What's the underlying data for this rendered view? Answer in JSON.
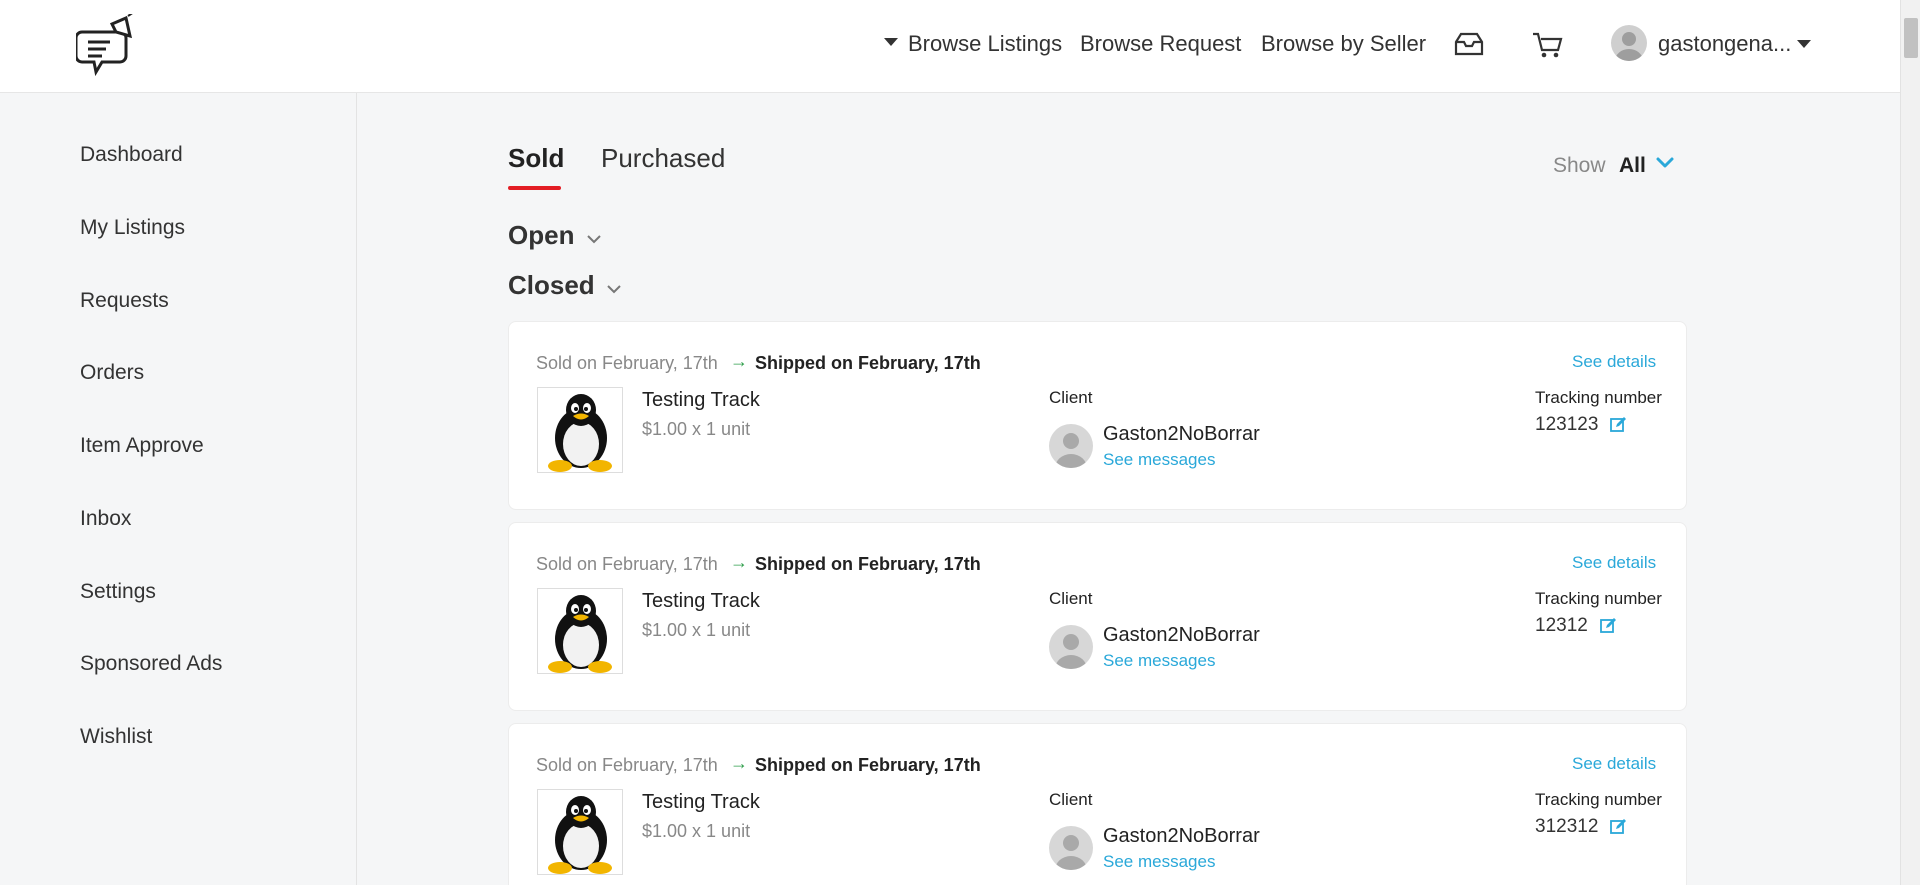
{
  "header": {
    "nav": {
      "browse_listings": "Browse Listings",
      "browse_request": "Browse Request",
      "browse_by_seller": "Browse by Seller"
    },
    "user_name": "gastongena...",
    "icons": [
      "logo-icon",
      "inbox-icon",
      "cart-icon",
      "avatar-icon",
      "chevron-down-icon"
    ]
  },
  "sidebar": {
    "items": [
      {
        "label": "Dashboard"
      },
      {
        "label": "My Listings"
      },
      {
        "label": "Requests"
      },
      {
        "label": "Orders"
      },
      {
        "label": "Item Approve"
      },
      {
        "label": "Inbox"
      },
      {
        "label": "Settings"
      },
      {
        "label": "Sponsored Ads"
      },
      {
        "label": "Wishlist"
      }
    ]
  },
  "main": {
    "tabs": [
      {
        "label": "Sold",
        "active": true
      },
      {
        "label": "Purchased",
        "active": false
      }
    ],
    "show_label": "Show",
    "show_value": "All",
    "sections": {
      "open": "Open",
      "closed": "Closed"
    },
    "orders": [
      {
        "sold_on": "Sold on February, 17th",
        "shipped": "Shipped on February, 17th",
        "see_details": "See details",
        "item_title": "Testing Track",
        "item_price": "$1.00 x 1 unit",
        "client_label": "Client",
        "client_name": "Gaston2NoBorrar",
        "see_messages": "See messages",
        "tracking_label": "Tracking number",
        "tracking_number": "123123"
      },
      {
        "sold_on": "Sold on February, 17th",
        "shipped": "Shipped on February, 17th",
        "see_details": "See details",
        "item_title": "Testing Track",
        "item_price": "$1.00 x 1 unit",
        "client_label": "Client",
        "client_name": "Gaston2NoBorrar",
        "see_messages": "See messages",
        "tracking_label": "Tracking number",
        "tracking_number": "12312"
      },
      {
        "sold_on": "Sold on February, 17th",
        "shipped": "Shipped on February, 17th",
        "see_details": "See details",
        "item_title": "Testing Track",
        "item_price": "$1.00 x 1 unit",
        "client_label": "Client",
        "client_name": "Gaston2NoBorrar",
        "see_messages": "See messages",
        "tracking_label": "Tracking number",
        "tracking_number": "312312"
      }
    ]
  },
  "colors": {
    "accent_red": "#e31d24",
    "link_blue": "#2aa8d9",
    "arrow_green": "#2e9e4b"
  }
}
